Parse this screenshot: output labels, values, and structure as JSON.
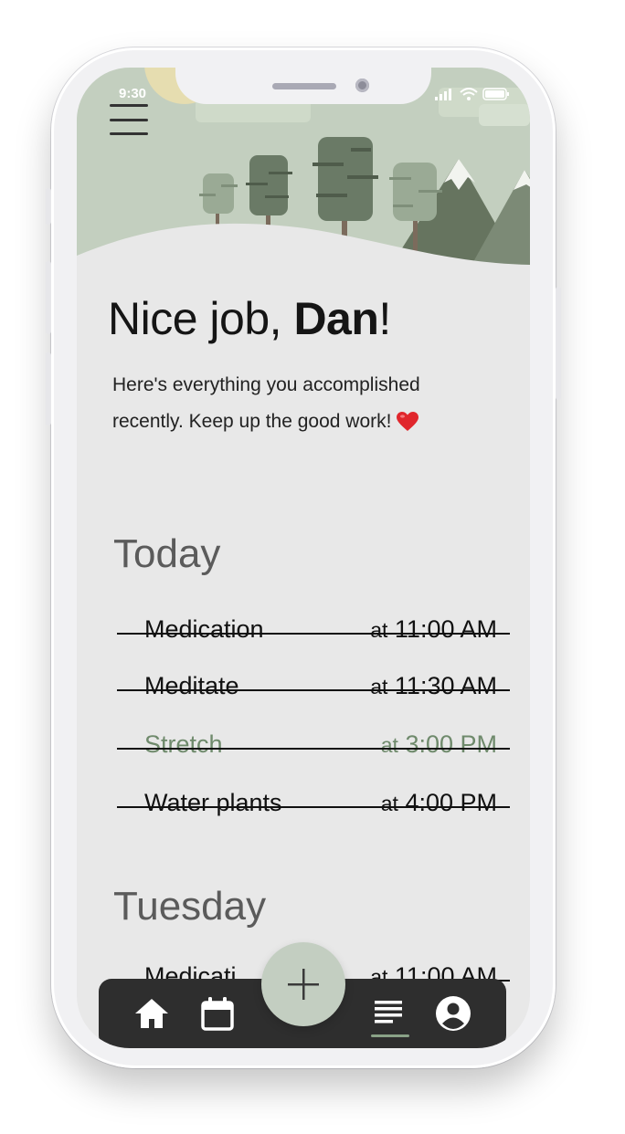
{
  "status": {
    "time": "9:30"
  },
  "header": {
    "greeting_prefix": "Nice job, ",
    "user_name": "Dan",
    "greeting_suffix": "!",
    "intro": "Here's everything you accomplished recently. Keep up the good work!"
  },
  "sections": [
    {
      "title": "Today",
      "tasks": [
        {
          "name": "Medication",
          "at": "at",
          "time": "11:00 AM",
          "completed": true
        },
        {
          "name": "Meditate",
          "at": "at",
          "time": "11:30 AM",
          "completed": true
        },
        {
          "name": "Stretch",
          "at": "at",
          "time": "3:00 PM",
          "completed": true,
          "faded": true
        },
        {
          "name": "Water plants",
          "at": "at",
          "time": "4:00 PM",
          "completed": true
        }
      ]
    },
    {
      "title": "Tuesday",
      "tasks": [
        {
          "name": "Medicati",
          "at": "at",
          "time": "11:00 AM",
          "completed": true,
          "partially_hidden": true
        }
      ]
    }
  ],
  "nav": {
    "items": [
      {
        "icon": "home-icon",
        "active": false
      },
      {
        "icon": "calendar-icon",
        "active": false
      },
      {
        "icon": "list-icon",
        "active": true
      },
      {
        "icon": "account-icon",
        "active": false
      }
    ],
    "fab_icon": "plus-icon"
  },
  "colors": {
    "sage": "#c3cec1",
    "dark_tree": "#6a7a66",
    "nav_bg": "#2e2e2e",
    "screen_bg": "#e8e8e8",
    "faded_text": "#6f8a6c"
  }
}
